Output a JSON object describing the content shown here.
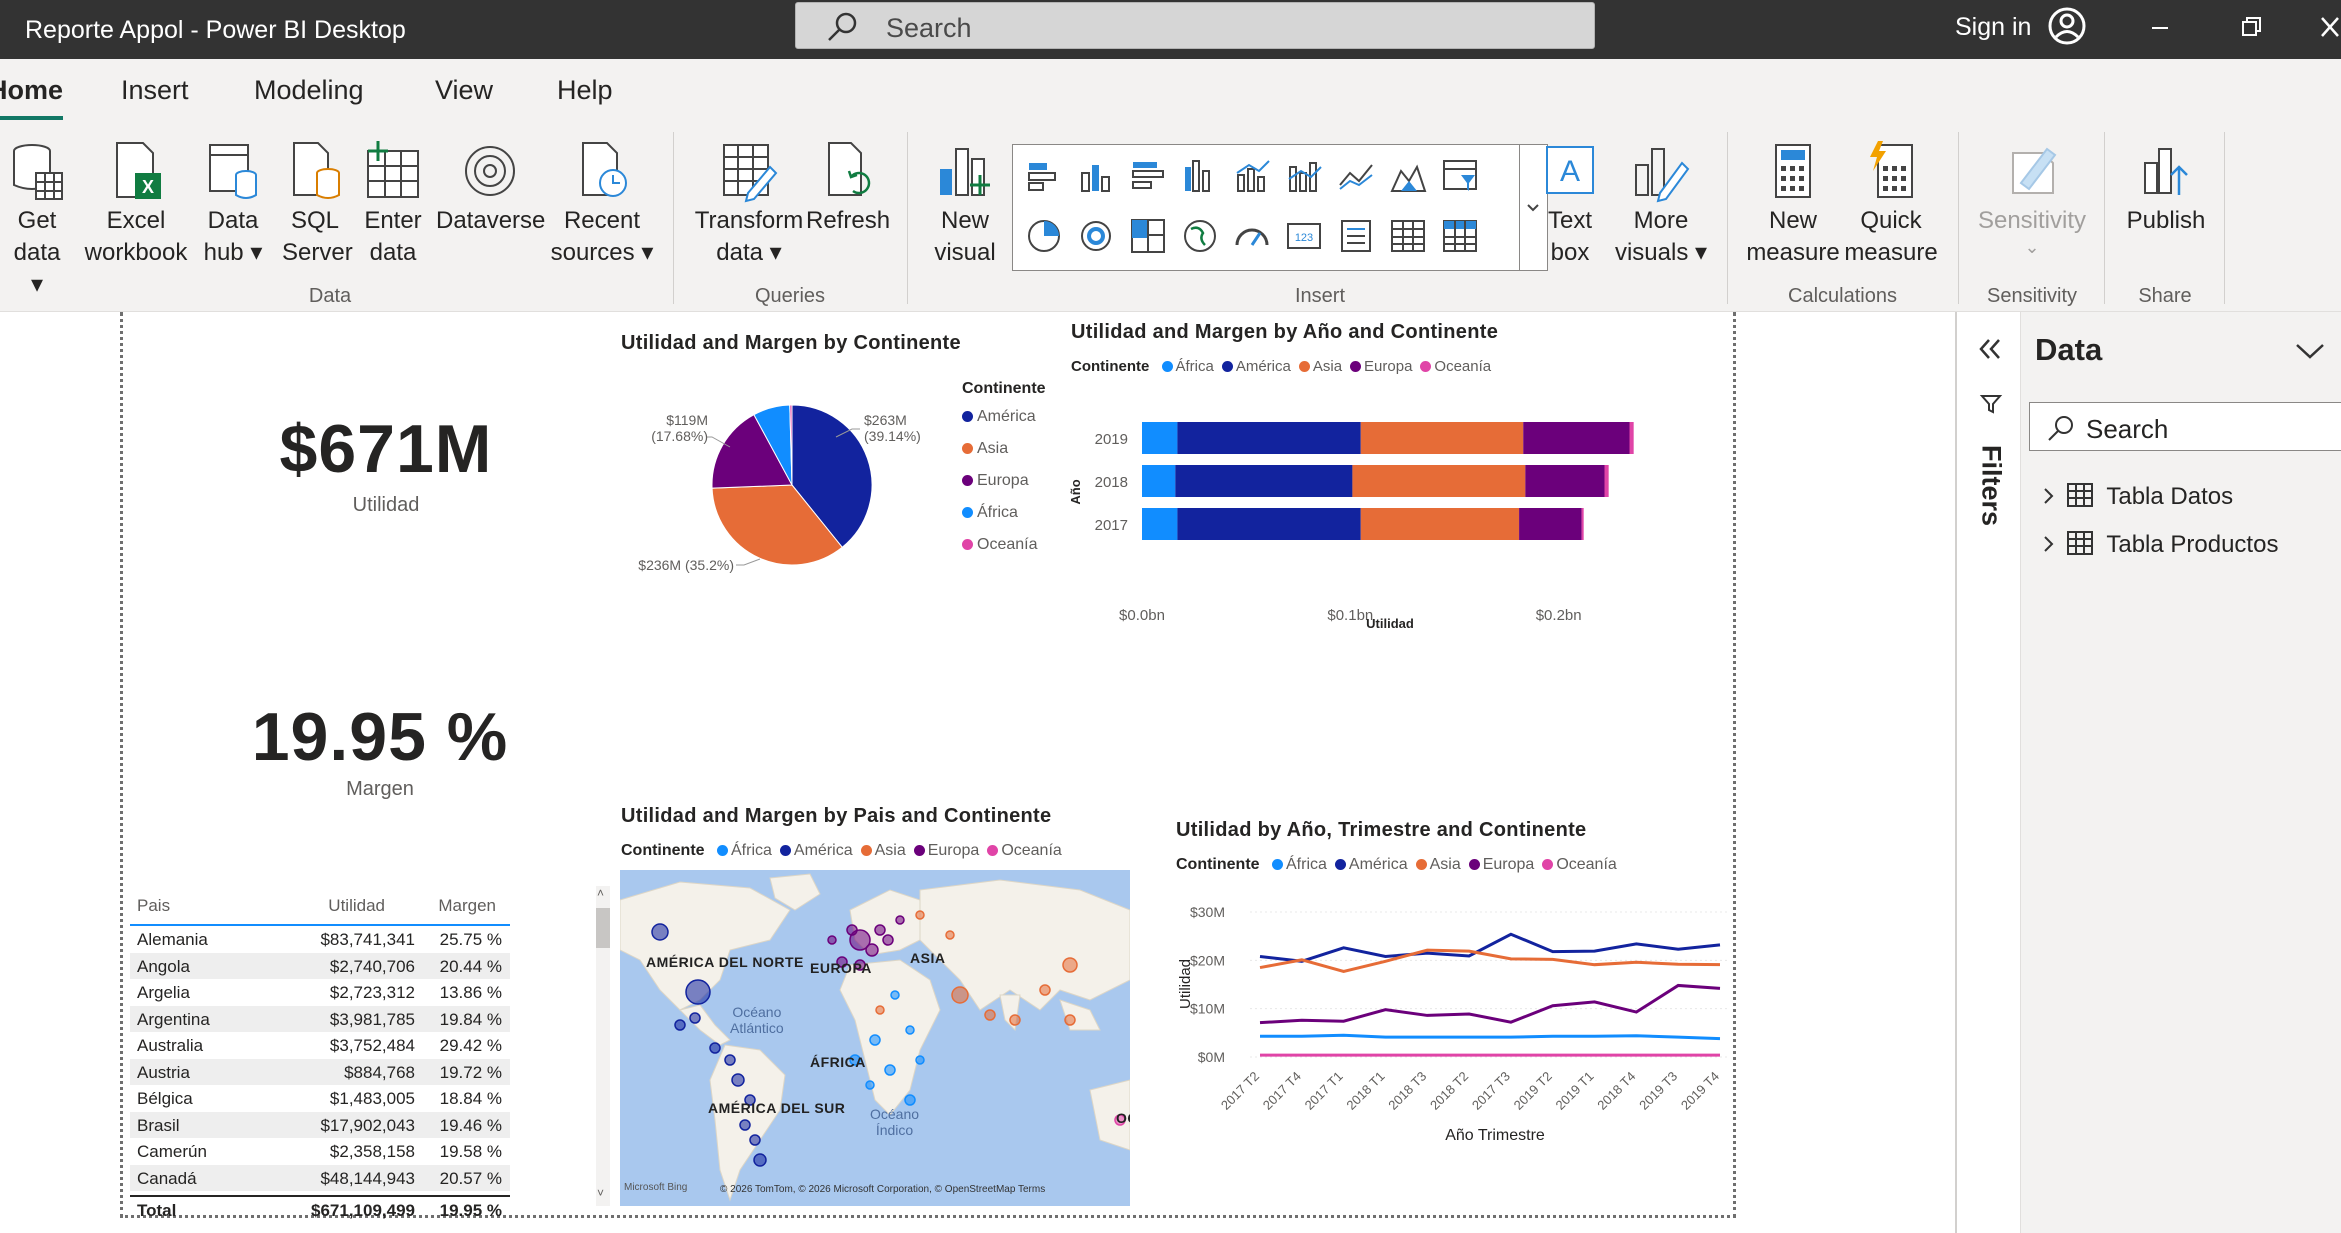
{
  "window": {
    "title": "Reporte Appol - Power BI Desktop",
    "search_placeholder": "Search",
    "sign_in": "Sign in"
  },
  "tabs": [
    "Home",
    "Insert",
    "Modeling",
    "View",
    "Help"
  ],
  "ribbon": {
    "data_group": {
      "label": "Data",
      "get_data": [
        "Get",
        "data"
      ],
      "excel": [
        "Excel",
        "workbook"
      ],
      "data_hub": [
        "Data",
        "hub"
      ],
      "sql": [
        "SQL",
        "Server"
      ],
      "enter": [
        "Enter",
        "data"
      ],
      "dataverse": "Dataverse",
      "recent": [
        "Recent",
        "sources"
      ]
    },
    "queries_group": {
      "label": "Queries",
      "transform": [
        "Transform",
        "data"
      ],
      "refresh": "Refresh"
    },
    "insert_group": {
      "label": "Insert",
      "new_visual": [
        "New",
        "visual"
      ],
      "text_box": [
        "Text",
        "box"
      ],
      "more_visuals": [
        "More",
        "visuals"
      ]
    },
    "calc_group": {
      "label": "Calculations",
      "new_measure": [
        "New",
        "measure"
      ],
      "quick_measure": [
        "Quick",
        "measure"
      ]
    },
    "sensitivity_group": {
      "label": "Sensitivity",
      "btn": "Sensitivity"
    },
    "share_group": {
      "label": "Share",
      "publish": "Publish"
    }
  },
  "cards": [
    {
      "value": "$671M",
      "label": "Utilidad"
    },
    {
      "value": "19.95 %",
      "label": "Margen"
    }
  ],
  "colors": {
    "africa": "#118dff",
    "america": "#12239e",
    "asia": "#e66c37",
    "europa": "#6b007b",
    "oceania": "#e044a7"
  },
  "pie": {
    "title": "Utilidad and Margen by Continente",
    "legend_title": "Continente",
    "legend": [
      "América",
      "Asia",
      "Europa",
      "África",
      "Oceanía"
    ],
    "labels": {
      "america": [
        "$263M",
        "(39.14%)"
      ],
      "asia": "$236M (35.2%)",
      "europa": [
        "$119M",
        "(17.68%)"
      ]
    }
  },
  "bar": {
    "title": "Utilidad and Margen by Año and Continente",
    "legend_title": "Continente",
    "legend": [
      "África",
      "América",
      "Asia",
      "Europa",
      "Oceanía"
    ],
    "ylabel": "Año",
    "xlabel": "Utilidad",
    "xticks": [
      "$0.0bn",
      "$0.1bn",
      "$0.2bn"
    ]
  },
  "table": {
    "headers": [
      "Pais",
      "Utilidad",
      "Margen"
    ],
    "rows": [
      [
        "Alemania",
        "$83,741,341",
        "25.75 %"
      ],
      [
        "Angola",
        "$2,740,706",
        "20.44 %"
      ],
      [
        "Argelia",
        "$2,723,312",
        "13.86 %"
      ],
      [
        "Argentina",
        "$3,981,785",
        "19.84 %"
      ],
      [
        "Australia",
        "$3,752,484",
        "29.42 %"
      ],
      [
        "Austria",
        "$884,768",
        "19.72 %"
      ],
      [
        "Bélgica",
        "$1,483,005",
        "18.84 %"
      ],
      [
        "Brasil",
        "$17,902,043",
        "19.46 %"
      ],
      [
        "Camerún",
        "$2,358,158",
        "19.58 %"
      ],
      [
        "Canadá",
        "$48,144,943",
        "20.57 %"
      ]
    ],
    "total": [
      "Total",
      "$671,109,499",
      "19.95 %"
    ]
  },
  "map": {
    "title": "Utilidad and Margen by Pais and Continente",
    "legend_title": "Continente",
    "legend": [
      "África",
      "América",
      "Asia",
      "Europa",
      "Oceanía"
    ],
    "labels": {
      "north_america": "AMÉRICA DEL NORTE",
      "europe": "EUROPA",
      "asia": "ASIA",
      "africa": "ÁFRICA",
      "south_america": "AMÉRICA DEL SUR",
      "atlantic": [
        "Océano",
        "Atlántico"
      ],
      "indian": [
        "Océano",
        "Índico"
      ],
      "oceania_cut": "OC"
    },
    "copyright": "© 2026 TomTom, © 2026 Microsoft Corporation, © OpenStreetMap  Terms",
    "bing": "Microsoft Bing"
  },
  "line": {
    "title": "Utilidad by Año, Trimestre and Continente",
    "legend_title": "Continente",
    "legend": [
      "África",
      "América",
      "Asia",
      "Europa",
      "Oceanía"
    ],
    "ylabel": "Utilidad",
    "xlabel": "Año Trimestre",
    "yticks": [
      "$30M",
      "$20M",
      "$10M",
      "$0M"
    ]
  },
  "chart_data": [
    {
      "type": "pie",
      "title": "Utilidad and Margen by Continente",
      "categories": [
        "América",
        "Asia",
        "Europa",
        "África",
        "Oceanía"
      ],
      "values": [
        263,
        236,
        119,
        50,
        3
      ],
      "percent": [
        39.14,
        35.2,
        17.68,
        7.5,
        0.5
      ]
    },
    {
      "type": "bar",
      "title": "Utilidad and Margen by Año and Continente",
      "categories": [
        "2019",
        "2018",
        "2017"
      ],
      "xlim": [
        0,
        0.24
      ],
      "series": [
        {
          "name": "África",
          "values": [
            0.017,
            0.016,
            0.017
          ]
        },
        {
          "name": "América",
          "values": [
            0.088,
            0.085,
            0.088
          ]
        },
        {
          "name": "Asia",
          "values": [
            0.078,
            0.083,
            0.076
          ]
        },
        {
          "name": "Europa",
          "values": [
            0.051,
            0.038,
            0.03
          ]
        },
        {
          "name": "Oceanía",
          "values": [
            0.002,
            0.002,
            0.001
          ]
        }
      ],
      "xlabel": "Utilidad",
      "ylabel": "Año"
    },
    {
      "type": "line",
      "title": "Utilidad by Año, Trimestre and Continente",
      "x": [
        "2017 T2",
        "2017 T4",
        "2017 T1",
        "2018 T1",
        "2018 T3",
        "2018 T2",
        "2017 T3",
        "2019 T2",
        "2019 T1",
        "2018 T4",
        "2019 T3",
        "2019 T4"
      ],
      "ylim": [
        0,
        30
      ],
      "series": [
        {
          "name": "África",
          "values": [
            4.3,
            4.3,
            4.5,
            4.1,
            4.1,
            4.1,
            4.1,
            4.3,
            4.3,
            4.4,
            4.1,
            3.8
          ]
        },
        {
          "name": "América",
          "values": [
            20.8,
            19.8,
            22.6,
            20.8,
            21.5,
            20.9,
            25.4,
            21.8,
            21.9,
            23.4,
            22.3,
            23.2
          ]
        },
        {
          "name": "Asia",
          "values": [
            18.5,
            20.1,
            17.7,
            19.8,
            22.1,
            21.9,
            20.3,
            20.2,
            19.1,
            19.6,
            19.2,
            19.1
          ]
        },
        {
          "name": "Europa",
          "values": [
            7.1,
            7.6,
            7.4,
            9.8,
            8.6,
            8.9,
            7.2,
            10.6,
            11.4,
            9.3,
            14.8,
            14.2
          ]
        },
        {
          "name": "Oceanía",
          "values": [
            0.4,
            0.4,
            0.4,
            0.4,
            0.4,
            0.4,
            0.4,
            0.4,
            0.4,
            0.4,
            0.4,
            0.4
          ]
        }
      ],
      "xlabel": "Año Trimestre",
      "ylabel": "Utilidad"
    }
  ],
  "panes": {
    "filters": "Filters",
    "data_title": "Data",
    "search": "Search",
    "tables": [
      "Tabla Datos",
      "Tabla Productos"
    ]
  }
}
